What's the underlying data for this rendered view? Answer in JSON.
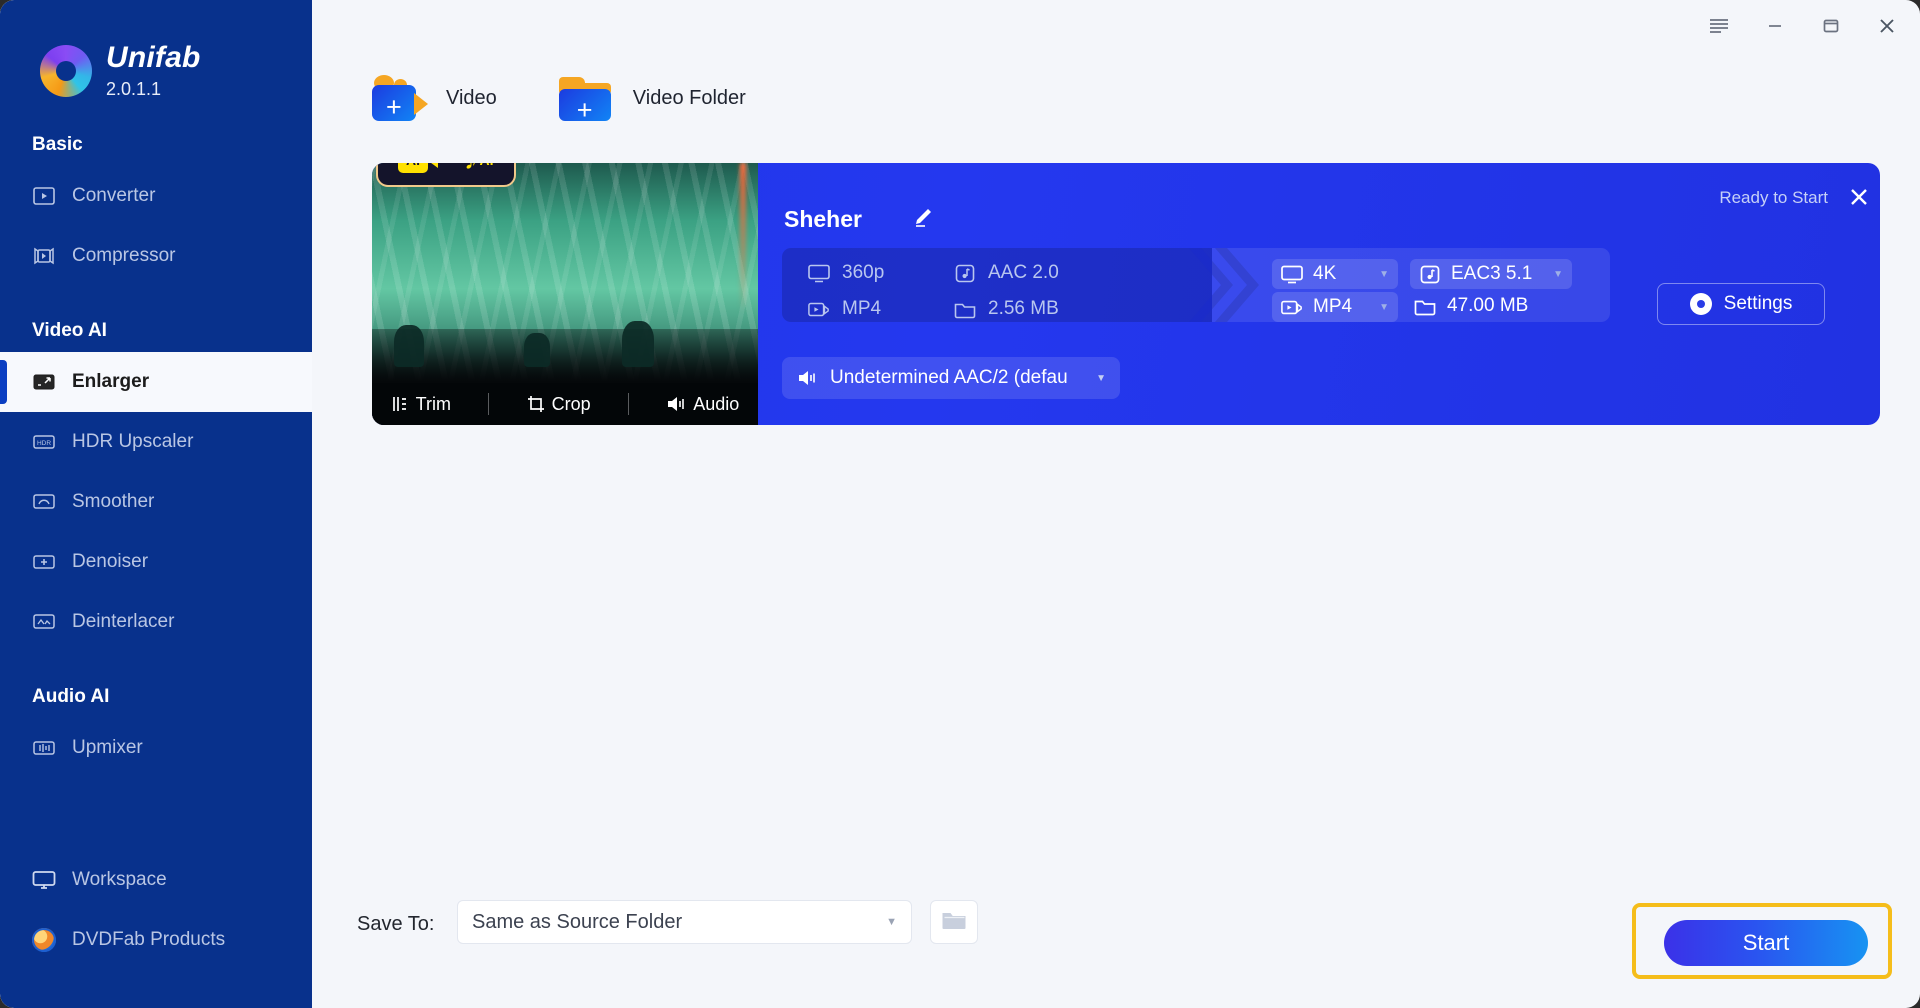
{
  "app": {
    "brand_name": "Unifab",
    "version": "2.0.1.1"
  },
  "window_controls": {
    "menu": "menu-icon",
    "minimize": "minimize-icon",
    "maximize": "maximize-icon",
    "close": "close-icon"
  },
  "sidebar": {
    "groups": [
      {
        "label": "Basic"
      },
      {
        "label": "Video AI"
      },
      {
        "label": "Audio AI"
      }
    ],
    "items": [
      {
        "label": "Converter",
        "icon": "converter-icon",
        "active": false
      },
      {
        "label": "Compressor",
        "icon": "compressor-icon",
        "active": false
      },
      {
        "label": "Enlarger",
        "icon": "enlarger-icon",
        "active": true
      },
      {
        "label": "HDR Upscaler",
        "icon": "hdr-icon",
        "active": false
      },
      {
        "label": "Smoother",
        "icon": "smoother-icon",
        "active": false
      },
      {
        "label": "Denoiser",
        "icon": "denoiser-icon",
        "active": false
      },
      {
        "label": "Deinterlacer",
        "icon": "deinterlacer-icon",
        "active": false
      },
      {
        "label": "Upmixer",
        "icon": "upmixer-icon",
        "active": false
      }
    ],
    "bottom_items": [
      {
        "label": "Workspace",
        "icon": "monitor-icon"
      },
      {
        "label": "DVDFab Products",
        "icon": "dvdfab-icon"
      }
    ]
  },
  "toolbar": {
    "add_video_label": "Video",
    "add_video_folder_label": "Video Folder"
  },
  "task": {
    "title": "Sheher",
    "status": "Ready to Start",
    "ai_badges": [
      "AI",
      "AI"
    ],
    "thumb_actions": [
      {
        "label": "Trim",
        "icon": "trim-icon"
      },
      {
        "label": "Crop",
        "icon": "crop-icon"
      },
      {
        "label": "Audio",
        "icon": "audio-icon"
      }
    ],
    "source": {
      "resolution": "360p",
      "audio": "AAC 2.0",
      "format": "MP4",
      "size": "2.56 MB"
    },
    "output": {
      "resolution": "4K",
      "audio": "EAC3 5.1",
      "format": "MP4",
      "size": "47.00 MB"
    },
    "audio_track": "Undetermined AAC/2 (defau",
    "settings_label": "Settings"
  },
  "footer": {
    "save_to_label": "Save To:",
    "save_to_value": "Same as Source Folder",
    "browse_icon": "folder-icon",
    "start_label": "Start"
  },
  "colors": {
    "sidebar_bg": "#08318c",
    "card_bg": "#2438ef",
    "accent_yellow": "#f5bd1a",
    "ai_yellow": "#ffe100",
    "page_bg": "#f4f6fa"
  }
}
